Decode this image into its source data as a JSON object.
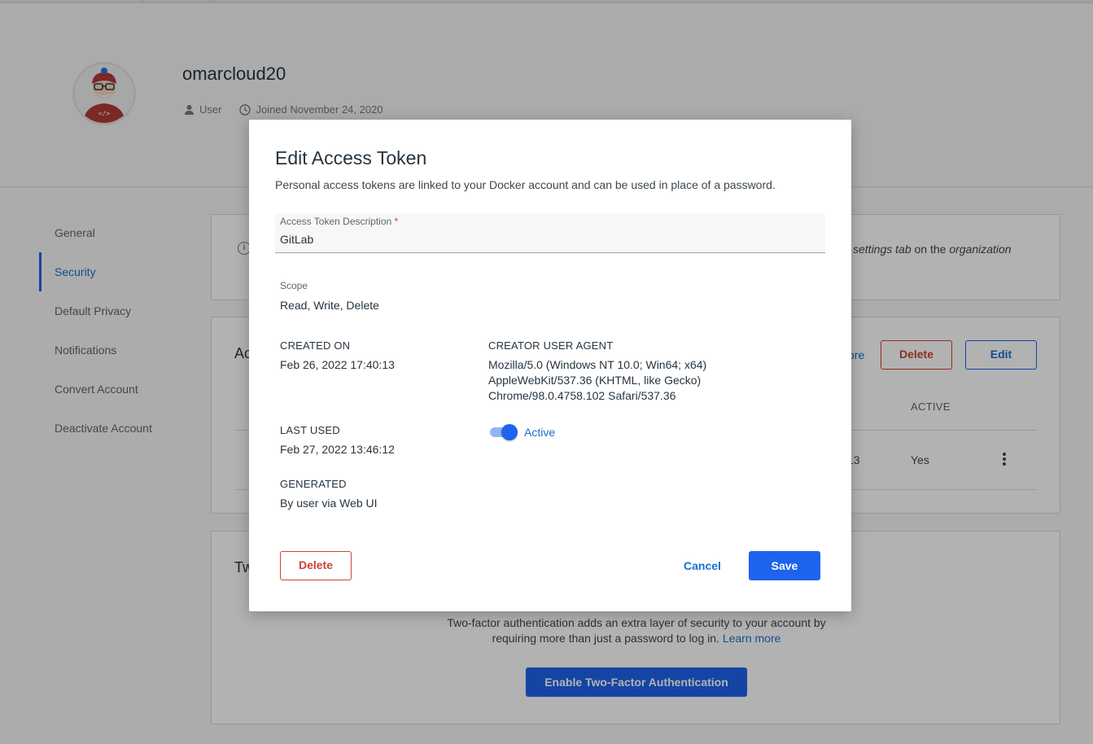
{
  "profile": {
    "username": "omarcloud20",
    "role": "User",
    "joined": "Joined November 24, 2020"
  },
  "sidebar": {
    "items": [
      {
        "label": "General"
      },
      {
        "label": "Security"
      },
      {
        "label": "Default Privacy"
      },
      {
        "label": "Notifications"
      },
      {
        "label": "Convert Account"
      },
      {
        "label": "Deactivate Account"
      }
    ],
    "active": "Security"
  },
  "info_card": {
    "text_italic1": "settings tab",
    "text_mid": " on the ",
    "text_italic2": "organization"
  },
  "tokens_card": {
    "title_fragment": "Ac",
    "more_fragment": "ore",
    "delete_label": "Delete",
    "edit_label": "Edit",
    "col_active": "ACTIVE",
    "row_fragment": "13",
    "row_active": "Yes"
  },
  "twofa_card": {
    "title_fragment": "Tw",
    "description_line1": "Two-factor authentication adds an extra layer of security to your account by",
    "description_line2": "requiring more than just a password to log in.",
    "learn_more": "Learn more",
    "enable_button": "Enable Two-Factor Authentication"
  },
  "modal": {
    "title": "Edit Access Token",
    "subtitle": "Personal access tokens are linked to your Docker account and can be used in place of a password.",
    "description_label": "Access Token Description",
    "required_mark": "*",
    "description_value": "GitLab",
    "scope_label": "Scope",
    "scope_value": "Read, Write, Delete",
    "created_on_label": "CREATED ON",
    "created_on_value": "Feb 26, 2022 17:40:13",
    "user_agent_label": "CREATOR USER AGENT",
    "user_agent_line1": "Mozilla/5.0 (Windows NT 10.0; Win64; x64)",
    "user_agent_line2": "AppleWebKit/537.36 (KHTML, like Gecko)",
    "user_agent_line3": "Chrome/98.0.4758.102 Safari/537.36",
    "last_used_label": "LAST USED",
    "last_used_value": "Feb 27, 2022 13:46:12",
    "active_toggle_on": true,
    "active_label": "Active",
    "generated_label": "GENERATED",
    "generated_value": "By user via Web UI",
    "delete_label": "Delete",
    "cancel_label": "Cancel",
    "save_label": "Save"
  },
  "colors": {
    "accent": "#1d63ed",
    "danger": "#c94435",
    "overlay": "rgba(0,0,0,0.30)"
  }
}
